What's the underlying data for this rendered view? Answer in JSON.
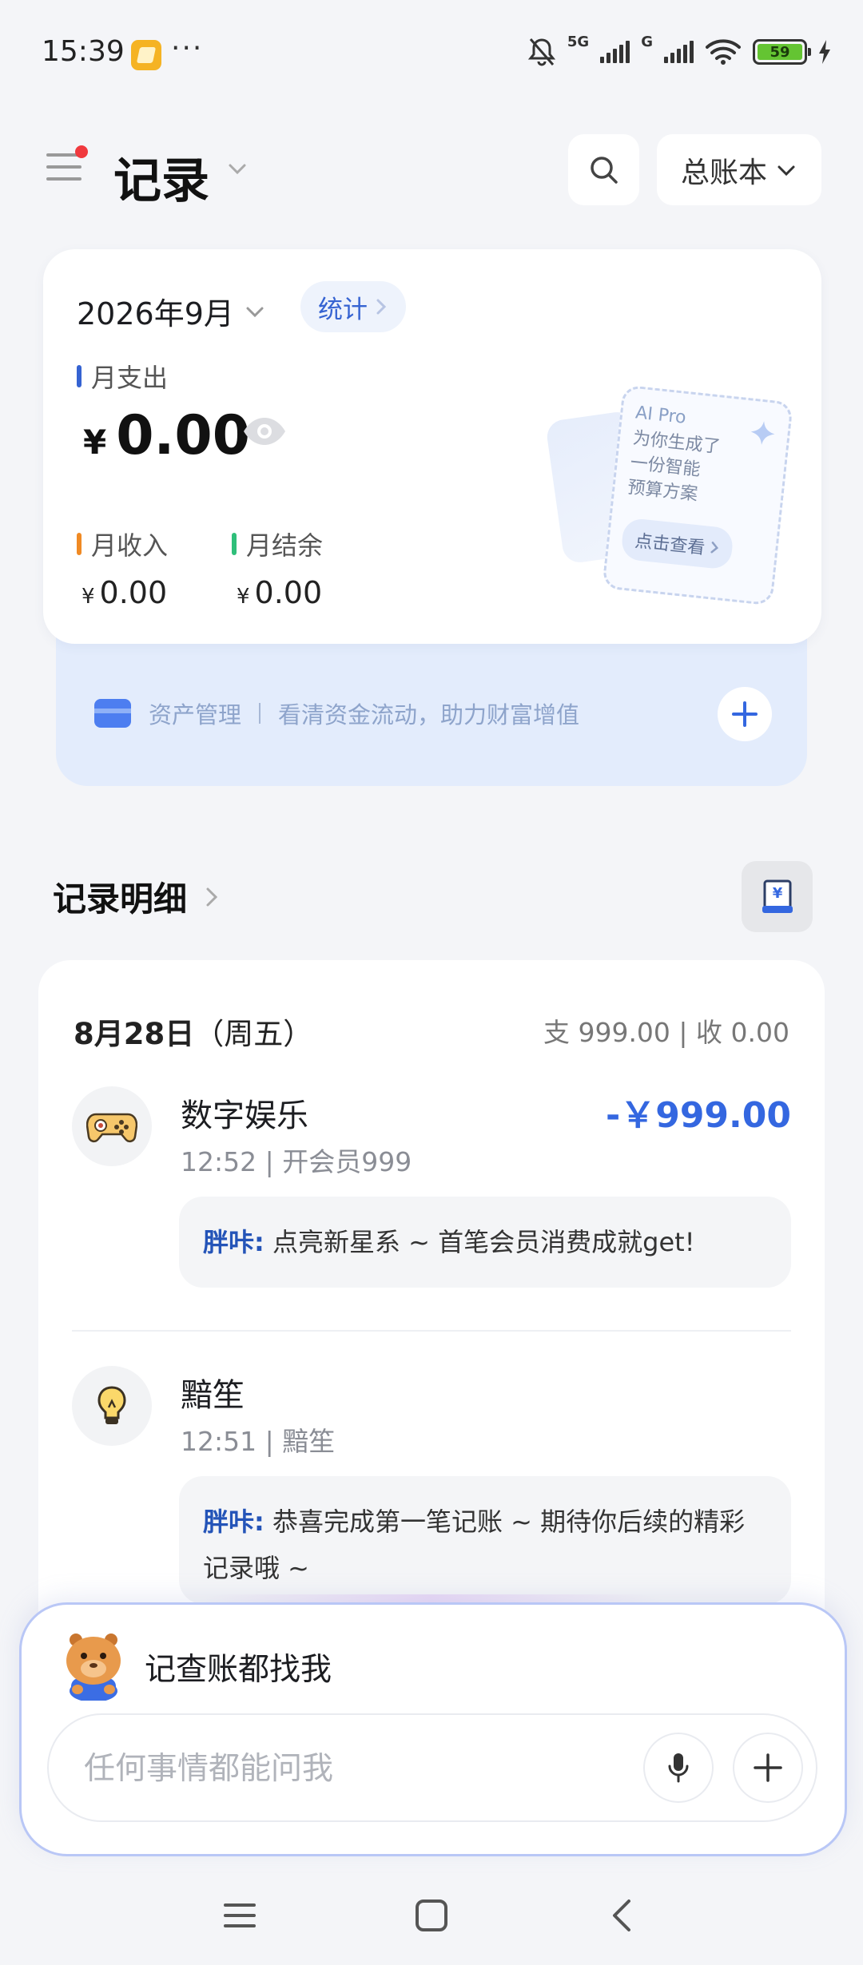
{
  "status_bar": {
    "time": "15:39",
    "dots": "···",
    "network": "5G",
    "network2": "G",
    "battery": "59"
  },
  "header": {
    "title": "记录",
    "ledger_label": "总账本"
  },
  "summary": {
    "month": "2026年9月",
    "stats_label": "统计",
    "expense_label": "月支出",
    "expense_currency": "¥",
    "expense_value": "0.00",
    "income_label": "月收入",
    "income_currency": "¥",
    "income_value": "0.00",
    "balance_label": "月结余",
    "balance_currency": "¥",
    "balance_value": "0.00",
    "ai_promo": {
      "title": "AI Pro",
      "line1": "为你生成了",
      "line2": "一份智能",
      "line3": "预算方案",
      "button": "点击查看"
    }
  },
  "assets": {
    "title": "资产管理",
    "desc": "看清资金流动，助力财富增值"
  },
  "records": {
    "title": "记录明细",
    "day": {
      "date": "8月28日",
      "weekday": "（周五）",
      "summary": "支 999.00 | 收 0.00"
    },
    "items": [
      {
        "name": "数字娱乐",
        "meta": "12:52 | 开会员999",
        "amount": "-￥999.00",
        "comment_name": "胖咔:",
        "comment": "点亮新星系 ~ 首笔会员消费成就get!"
      },
      {
        "name": "黯笙",
        "meta": "12:51 | 黯笙",
        "amount": "",
        "comment_name": "胖咔:",
        "comment": "恭喜完成第一笔记账 ~ 期待你后续的精彩记录哦 ~"
      }
    ]
  },
  "assistant": {
    "title": "记查账都找我",
    "placeholder": "任何事情都能问我"
  },
  "colors": {
    "accent": "#3467e0",
    "expense_bar": "#3563d2",
    "income_bar": "#f08a24",
    "balance_bar": "#2fbf7a",
    "notification_dot": "#f0393e"
  }
}
